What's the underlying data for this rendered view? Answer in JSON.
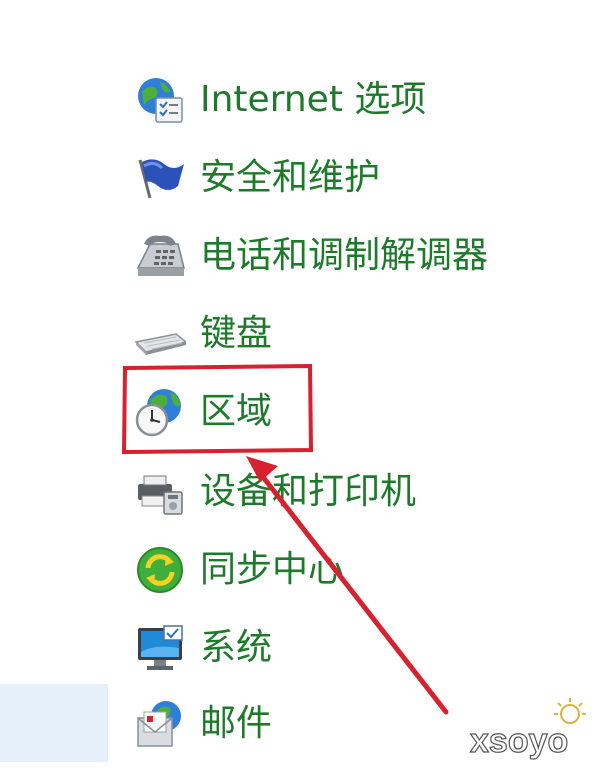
{
  "items": [
    {
      "label": "Internet 选项",
      "icon": "internet-options-icon"
    },
    {
      "label": "安全和维护",
      "icon": "security-maintenance-flag-icon"
    },
    {
      "label": "电话和调制解调器",
      "icon": "phone-modem-icon"
    },
    {
      "label": "键盘",
      "icon": "keyboard-icon"
    },
    {
      "label": "区域",
      "icon": "region-globe-clock-icon"
    },
    {
      "label": "设备和打印机",
      "icon": "devices-printers-icon"
    },
    {
      "label": "同步中心",
      "icon": "sync-center-icon"
    },
    {
      "label": "系统",
      "icon": "system-monitor-icon"
    },
    {
      "label": "邮件",
      "icon": "mail-icon"
    }
  ],
  "annotation": {
    "highlight_color": "#d8212f",
    "highlighted_item": "区域"
  },
  "colors": {
    "label": "#1d7a2a",
    "hover": "#e6f0fb"
  },
  "watermark": {
    "text": "xsoyo"
  }
}
